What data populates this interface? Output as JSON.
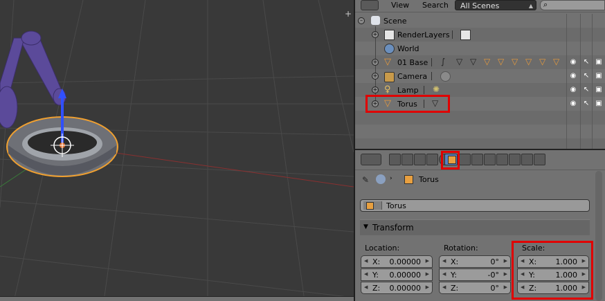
{
  "header": {
    "view_label": "View",
    "search_label": "Search",
    "scene_select": "All Scenes"
  },
  "outliner": {
    "items": [
      {
        "label": "Scene",
        "icon": "scene-icon"
      },
      {
        "label": "RenderLayers",
        "icon": "renderlayers-icon"
      },
      {
        "label": "World",
        "icon": "world-icon"
      },
      {
        "label": "01 Base",
        "icon": "mesh-object-icon"
      },
      {
        "label": "Camera",
        "icon": "camera-icon"
      },
      {
        "label": "Lamp",
        "icon": "lamp-icon"
      },
      {
        "label": "Torus",
        "icon": "mesh-object-icon"
      }
    ]
  },
  "properties": {
    "breadcrumb_object": "Torus",
    "object_name": "Torus",
    "panel_title": "Transform",
    "location": {
      "label": "Location:",
      "x_label": "X:",
      "x": "0.00000",
      "y_label": "Y:",
      "y": "0.00000",
      "z_label": "Z:",
      "z": "0.00000"
    },
    "rotation": {
      "label": "Rotation:",
      "x_label": "X:",
      "x": "0°",
      "y_label": "Y:",
      "y": "-0°",
      "z_label": "Z:",
      "z": "0°"
    },
    "scale": {
      "label": "Scale:",
      "x_label": "X:",
      "x": "1.000",
      "y_label": "Y:",
      "y": "1.000",
      "z_label": "Z:",
      "z": "1.000"
    }
  },
  "colors": {
    "highlight": "#e00000",
    "active_tab": "#5680c2",
    "selection_outline": "#f0a030",
    "arm_purple": "#5b4a9a"
  }
}
